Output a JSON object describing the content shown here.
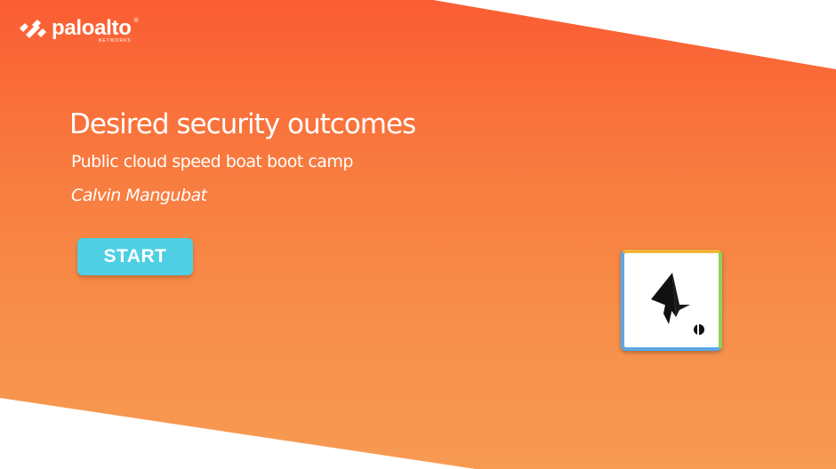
{
  "brand": {
    "logo_text": "paloalto",
    "registered_mark": "®",
    "sub_text": "NETWORKS"
  },
  "slide": {
    "title": "Desired security outcomes",
    "subtitle": "Public cloud speed boat boot camp",
    "author": "Calvin Mangubat"
  },
  "controls": {
    "start_label": "START"
  },
  "colors": {
    "banner_top": "#fb5d33",
    "banner_bottom": "#f79a53",
    "start_button": "#4ecfe4",
    "text": "#ffffff"
  },
  "icons": {
    "brand": "paloalto-logo-icon",
    "badge": "course-badge-icon"
  }
}
